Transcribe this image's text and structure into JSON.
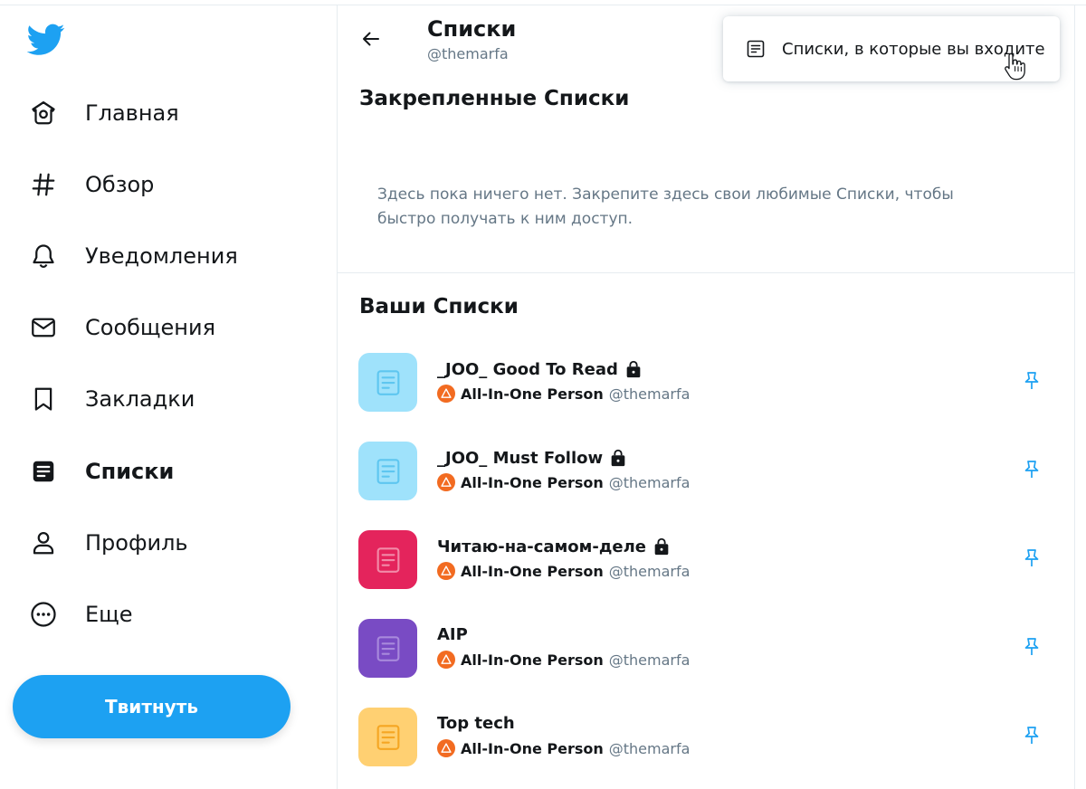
{
  "sidebar": {
    "logo_icon": "twitter-bird-icon",
    "items": [
      {
        "label": "Главная",
        "icon": "home-icon",
        "active": false
      },
      {
        "label": "Обзор",
        "icon": "hashtag-icon",
        "active": false
      },
      {
        "label": "Уведомления",
        "icon": "bell-icon",
        "active": false
      },
      {
        "label": "Сообщения",
        "icon": "envelope-icon",
        "active": false
      },
      {
        "label": "Закладки",
        "icon": "bookmark-icon",
        "active": false
      },
      {
        "label": "Списки",
        "icon": "lists-icon",
        "active": true
      },
      {
        "label": "Профиль",
        "icon": "profile-icon",
        "active": false
      },
      {
        "label": "Еще",
        "icon": "more-icon",
        "active": false
      }
    ],
    "tweet_button": "Твитнуть"
  },
  "header": {
    "title": "Списки",
    "handle": "@themarfa"
  },
  "pinned": {
    "title": "Закрепленные Списки",
    "empty_text": "Здесь пока ничего нет. Закрепите здесь свои любимые Списки, чтобы быстро получать к ним доступ."
  },
  "your_lists": {
    "title": "Ваши Списки",
    "items": [
      {
        "name": "_JOO_ Good To Read",
        "private": true,
        "owner": "All-In-One Person",
        "handle": "@themarfa",
        "color": "#9fe2fb"
      },
      {
        "name": "_JOO_ Must Follow",
        "private": true,
        "owner": "All-In-One Person",
        "handle": "@themarfa",
        "color": "#9fe2fb"
      },
      {
        "name": "Читаю-на-самом-деле",
        "private": true,
        "owner": "All-In-One Person",
        "handle": "@themarfa",
        "color": "#e4245c"
      },
      {
        "name": "AIP",
        "private": false,
        "owner": "All-In-One Person",
        "handle": "@themarfa",
        "color": "#794bc4"
      },
      {
        "name": "Top tech",
        "private": false,
        "owner": "All-In-One Person",
        "handle": "@themarfa",
        "color": "#ffd072"
      }
    ]
  },
  "dropdown": {
    "label": "Списки, в которые вы входите",
    "icon": "list-document-icon"
  },
  "colors": {
    "accent": "#1da1f2",
    "text": "#14171a",
    "muted": "#657786",
    "border": "#e6ecf0"
  }
}
